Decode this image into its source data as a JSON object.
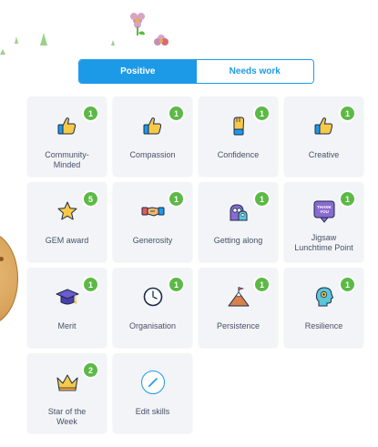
{
  "colors": {
    "accent": "#1c9ae8",
    "badge": "#5cb946",
    "card_bg": "#f3f4f7",
    "label": "#46506a"
  },
  "tabs": [
    {
      "label": "Positive",
      "active": true
    },
    {
      "label": "Needs work",
      "active": false
    }
  ],
  "skills": [
    {
      "label": "Community-\nMinded",
      "count": "1",
      "icon": "thumbs-up-icon"
    },
    {
      "label": "Compassion",
      "count": "1",
      "icon": "thumbs-up-icon"
    },
    {
      "label": "Confidence",
      "count": "1",
      "icon": "raised-fist-icon"
    },
    {
      "label": "Creative",
      "count": "1",
      "icon": "thumbs-up-icon"
    },
    {
      "label": "GEM award",
      "count": "5",
      "icon": "star-icon"
    },
    {
      "label": "Generosity",
      "count": "1",
      "icon": "handshake-icon"
    },
    {
      "label": "Getting along",
      "count": "1",
      "icon": "monsters-group-icon"
    },
    {
      "label": "Jigsaw\nLunchtime Point",
      "count": "1",
      "icon": "thank-you-card-icon"
    },
    {
      "label": "Merit",
      "count": "1",
      "icon": "graduation-cap-icon"
    },
    {
      "label": "Organisation",
      "count": "1",
      "icon": "clock-icon"
    },
    {
      "label": "Persistence",
      "count": "1",
      "icon": "mountain-flag-icon"
    },
    {
      "label": "Resilience",
      "count": "1",
      "icon": "head-profile-icon"
    },
    {
      "label": "Star of the\nWeek",
      "count": "2",
      "icon": "crown-icon"
    }
  ],
  "edit_skills": {
    "label": "Edit skills",
    "icon": "pencil-icon"
  },
  "tab_thank_you_text": "THANK YOU"
}
